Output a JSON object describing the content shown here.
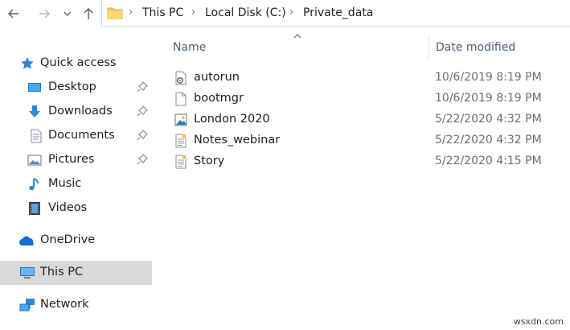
{
  "toolbar": {
    "back": "back-arrow-icon",
    "forward": "forward-arrow-icon",
    "recent": "chevron-down-icon",
    "up": "up-arrow-icon"
  },
  "breadcrumb": {
    "items": [
      "This PC",
      "Local Disk (C:)",
      "Private_data"
    ]
  },
  "nav": {
    "quick_access": "Quick access",
    "desktop": "Desktop",
    "downloads": "Downloads",
    "documents": "Documents",
    "pictures": "Pictures",
    "music": "Music",
    "videos": "Videos",
    "onedrive": "OneDrive",
    "this_pc": "This PC",
    "network": "Network"
  },
  "list": {
    "columns": [
      "Name",
      "Date modified"
    ],
    "sort_indicator": "^",
    "rows": [
      {
        "name": "autorun",
        "date": "10/6/2019 8:19 PM",
        "icon": "settings-file-icon"
      },
      {
        "name": "bootmgr",
        "date": "10/6/2019 8:19 PM",
        "icon": "blank-file-icon"
      },
      {
        "name": "London 2020",
        "date": "5/22/2020 4:32 PM",
        "icon": "image-file-icon"
      },
      {
        "name": "Notes_webinar",
        "date": "5/22/2020 4:32 PM",
        "icon": "text-file-icon"
      },
      {
        "name": "Story",
        "date": "5/22/2020 4:15 PM",
        "icon": "text-file-icon"
      }
    ]
  },
  "watermark": "wsxdn.com",
  "colors": {
    "selected_bg": "#d9d9d9",
    "header_text": "#4c607a",
    "date_text": "#6d6d6d",
    "accent": "#2b88d8"
  }
}
